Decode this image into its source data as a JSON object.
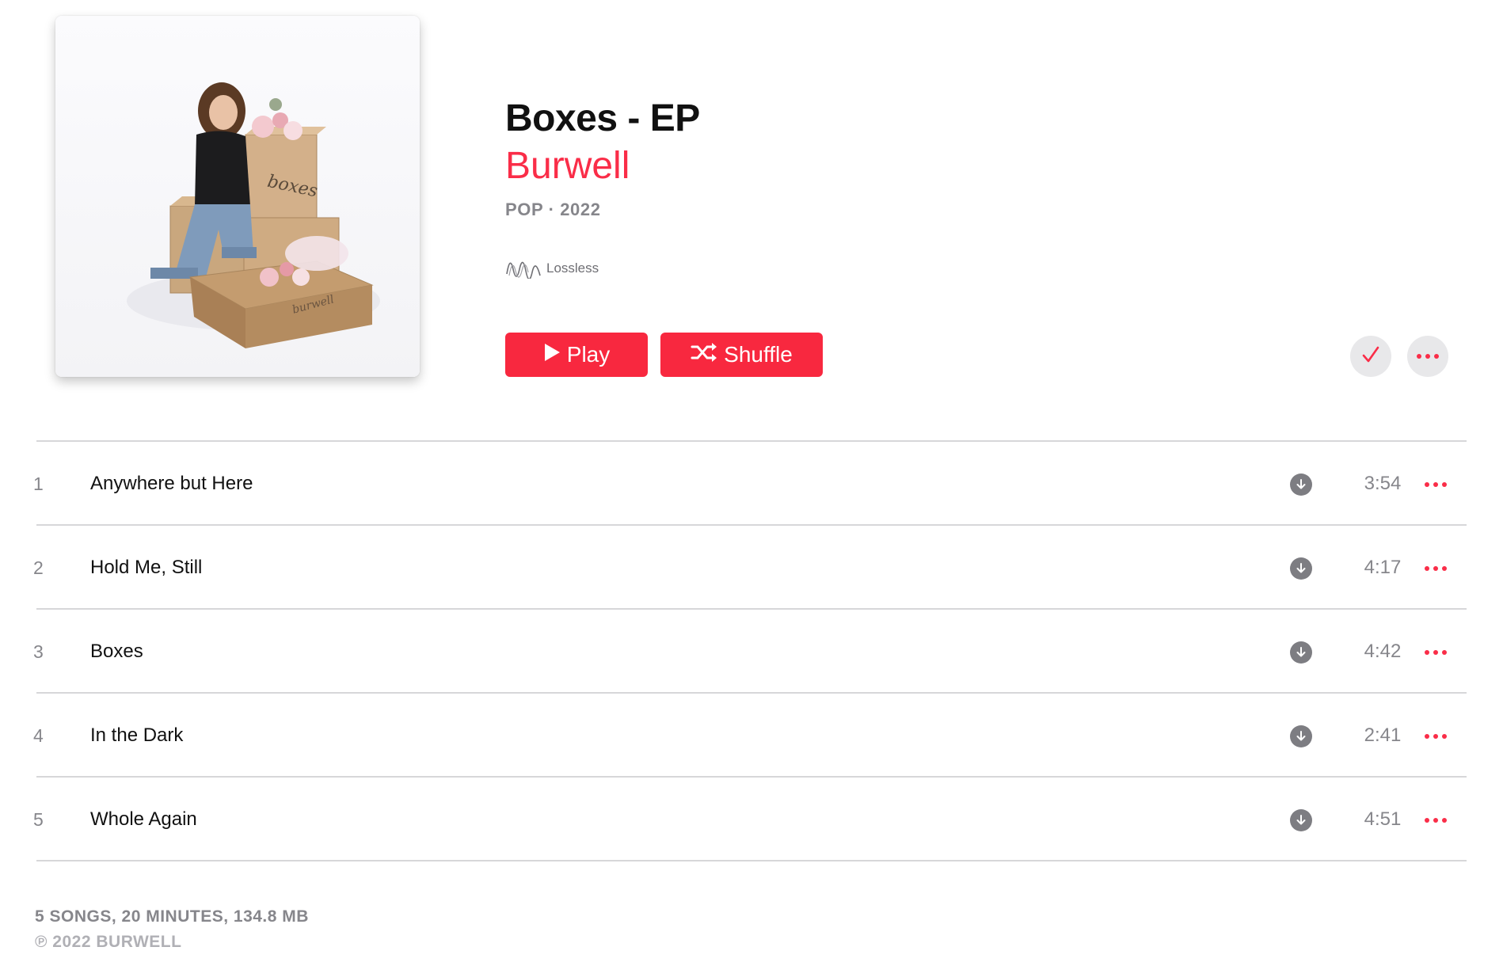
{
  "album": {
    "title": "Boxes - EP",
    "artist": "Burwell",
    "meta": "POP · 2022",
    "quality_label": "Lossless",
    "artwork_text": "boxes",
    "artwork_box_text": "burwell"
  },
  "actions": {
    "play_label": "Play",
    "shuffle_label": "Shuffle"
  },
  "tracks": [
    {
      "number": "1",
      "title": "Anywhere but Here",
      "duration": "3:54"
    },
    {
      "number": "2",
      "title": "Hold Me, Still",
      "duration": "4:17"
    },
    {
      "number": "3",
      "title": "Boxes",
      "duration": "4:42"
    },
    {
      "number": "4",
      "title": "In the Dark",
      "duration": "2:41"
    },
    {
      "number": "5",
      "title": "Whole Again",
      "duration": "4:51"
    }
  ],
  "footer": {
    "summary": "5 SONGS, 20 MINUTES, 134.8 MB",
    "copyright": "℗ 2022 BURWELL"
  },
  "colors": {
    "accent": "#fa2d48",
    "button": "#f8283f",
    "secondary_text": "#86868b",
    "divider": "#d7d7d9"
  },
  "icons": {
    "play": "play-icon",
    "shuffle": "shuffle-icon",
    "check": "check-icon",
    "more": "more-icon",
    "download": "download-icon",
    "lossless": "lossless-wave-icon"
  }
}
